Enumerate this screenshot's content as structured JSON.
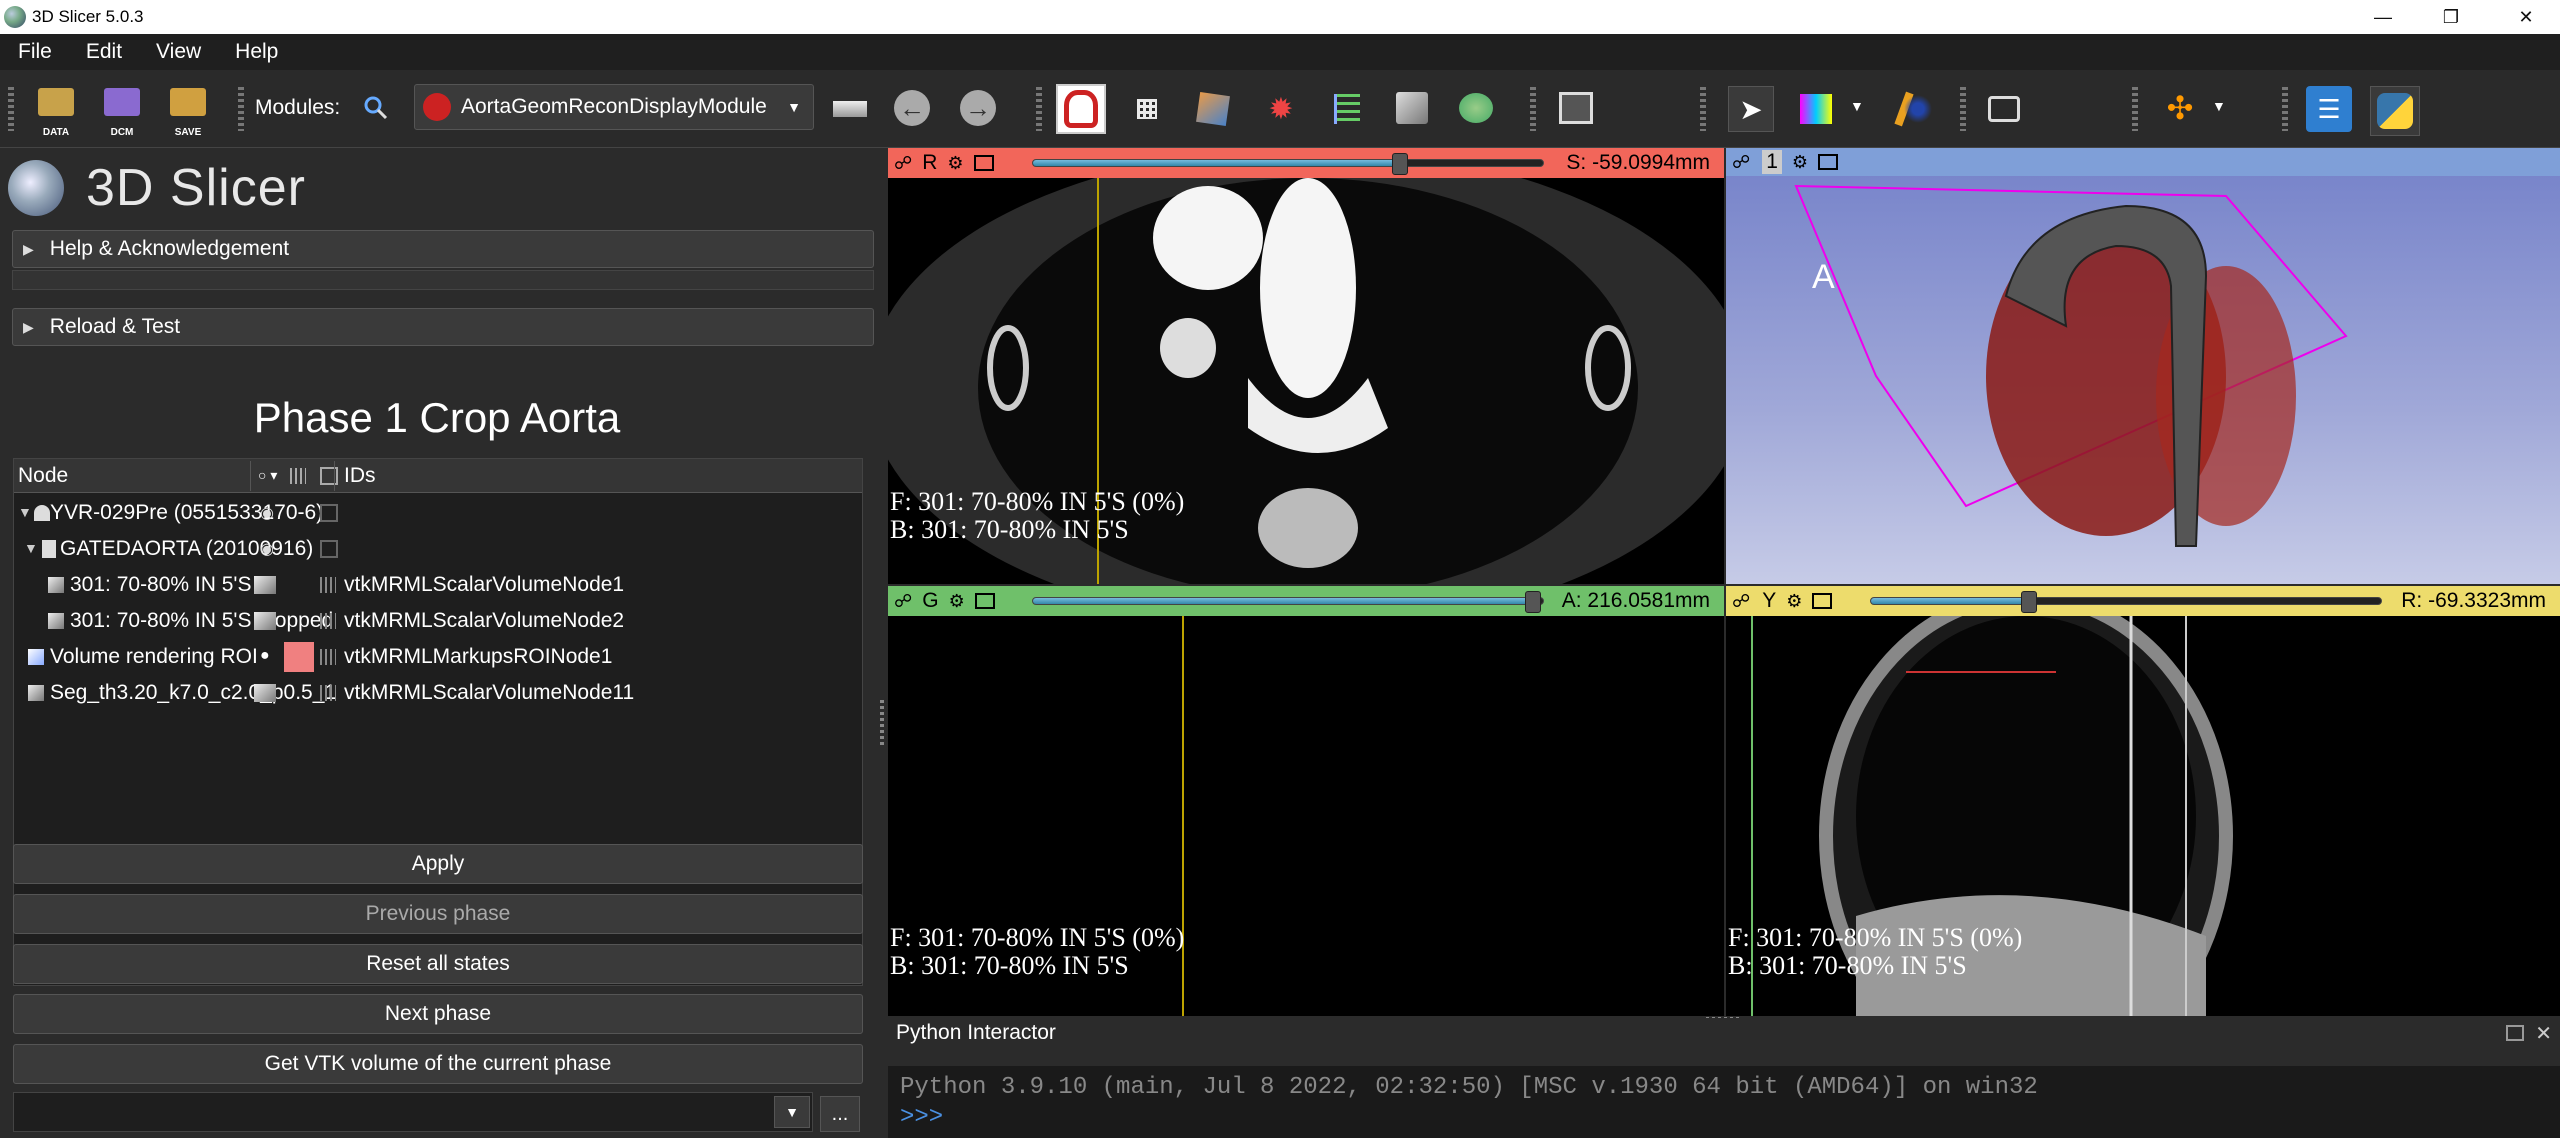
{
  "window": {
    "title": "3D Slicer 5.0.3",
    "minimize": "—",
    "maximize": "❐",
    "close": "✕"
  },
  "menu": [
    "File",
    "Edit",
    "View",
    "Help"
  ],
  "toolbar": {
    "data_label": "DATA",
    "dcm_label": "DCM",
    "save_label": "SAVE",
    "modules_label": "Modules:",
    "module_selected": "AortaGeomReconDisplayModule"
  },
  "brand": {
    "name": "3D Slicer"
  },
  "sections": {
    "help": "Help & Acknowledgement",
    "reload": "Reload & Test"
  },
  "phase_title": "Phase 1 Crop Aorta",
  "tree": {
    "columns": [
      "Node",
      "IDs"
    ],
    "rows": [
      {
        "label": "YVR-029Pre (0551533170-6)",
        "id": ""
      },
      {
        "label": "GATEDAORTA (20100916)",
        "id": ""
      },
      {
        "label": "301: 70-80% IN 5'S",
        "id": "vtkMRMLScalarVolumeNode1"
      },
      {
        "label": "301: 70-80% IN 5'S cropped",
        "id": "vtkMRMLScalarVolumeNode2"
      },
      {
        "label": "Volume rendering ROI",
        "id": "vtkMRMLMarkupsROINode1"
      },
      {
        "label": "Seg_th3.20_k7.0_c2.0_p0.5_1",
        "id": "vtkMRMLScalarVolumeNode11"
      }
    ]
  },
  "buttons": {
    "apply": "Apply",
    "previous": "Previous phase",
    "reset": "Reset all states",
    "next": "Next phase",
    "get_vtk": "Get VTK volume of the current phase",
    "more": "..."
  },
  "views": {
    "red": {
      "letter": "R",
      "offset": "S: -59.0994mm",
      "slider": 0.72,
      "fg": "F: 301: 70-80% IN 5'S (0%)",
      "bg": "B: 301: 70-80% IN 5'S",
      "color": "#f2665a"
    },
    "threed": {
      "letter": "1",
      "orientation": "A",
      "color": "#7f9fd8"
    },
    "green": {
      "letter": "G",
      "offset": "A: 216.0581mm",
      "slider": 0.98,
      "fg": "F: 301: 70-80% IN 5'S (0%)",
      "bg": "B: 301: 70-80% IN 5'S",
      "color": "#6fc06a"
    },
    "yellow": {
      "letter": "Y",
      "offset": "R: -69.3323mm",
      "slider": 0.31,
      "fg": "F: 301: 70-80% IN 5'S (0%)",
      "bg": "B: 301: 70-80% IN 5'S",
      "color": "#eddc6c"
    }
  },
  "python": {
    "title": "Python Interactor",
    "banner": "Python 3.9.10 (main, Jul  8 2022, 02:32:50) [MSC v.1930 64 bit (AMD64)] on win32",
    "prompt": ">>>"
  }
}
